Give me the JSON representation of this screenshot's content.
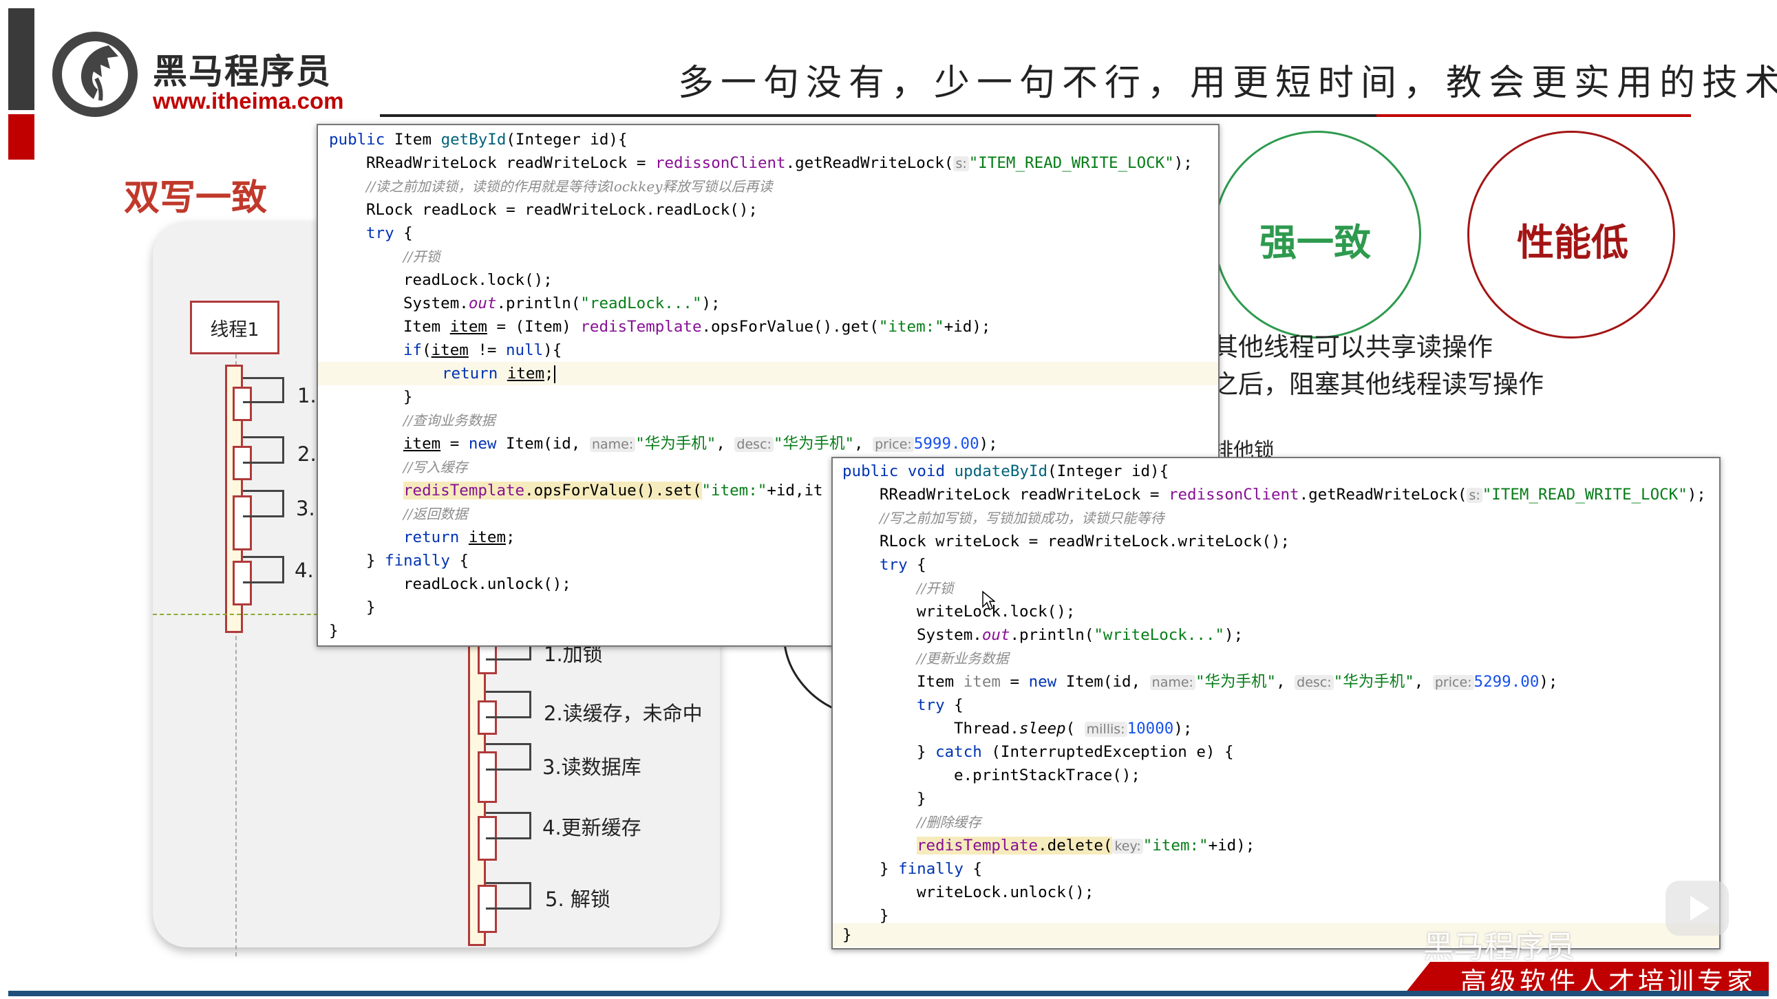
{
  "header": {
    "logo_name": "黑马程序员",
    "logo_url": "www.itheima.com",
    "slogan": "多一句没有，少一句不行，用更短时间，教会更实用的技术！"
  },
  "section_title": "双写一致",
  "diagram": {
    "thread_label": "线程1",
    "top_steps": [
      "1.",
      "2.",
      "3.",
      "4."
    ],
    "bottom_steps": [
      "1.加锁",
      "2.读缓存，未命中",
      "3.读数据库",
      "4.更新缓存",
      "5. 解锁"
    ]
  },
  "circles": {
    "left": {
      "label": "强一致",
      "color": "#2e9a4e"
    },
    "right": {
      "label": "性能低",
      "color": "#a31515"
    }
  },
  "side_text": {
    "line1": "其他线程可以共享读操作",
    "line2": "之后，阻塞其他线程读写操作",
    "line3": "排他锁"
  },
  "code_left": {
    "l1": {
      "a": "public ",
      "b": "Item ",
      "c": "getById",
      "d": "(Integer id){"
    },
    "l2": {
      "a": "RReadWriteLock readWriteLock = ",
      "b": "redissonClient",
      "c": ".getReadWriteLock(",
      "hint": "s:",
      "str": "\"ITEM_READ_WRITE_LOCK\"",
      "d": ");"
    },
    "l3": {
      "cm": "//读之前加读锁，读锁的作用就是等待该lockkey释放写锁以后再读"
    },
    "l4": {
      "a": "RLock readLock = readWriteLock.readLock();"
    },
    "l5": {
      "a": "try",
      "b": " {"
    },
    "l6": {
      "cm": "//开锁"
    },
    "l7": {
      "a": "readLock.lock();"
    },
    "l8": {
      "a": "System.",
      "b": "out",
      "c": ".println(",
      "str": "\"readLock...\"",
      "d": ");"
    },
    "l9": {
      "a": "Item ",
      "b": "item",
      "c": " = (Item) ",
      "d": "redisTemplate",
      "e": ".opsForValue().get(",
      "str": "\"item:\"",
      "f": "+id);"
    },
    "l10": {
      "a": "if",
      "b": "(",
      "c": "item",
      "d": " != ",
      "e": "null",
      "f": "){"
    },
    "l11": {
      "a": "return ",
      "b": "item",
      "c": ";"
    },
    "l12": {
      "a": "}"
    },
    "l13": {
      "cm": "//查询业务数据"
    },
    "l14": {
      "a": "item",
      "b": " = ",
      "c": "new ",
      "d": "Item(id, ",
      "h1": "name:",
      "s1": "\"华为手机\"",
      "e": ", ",
      "h2": "desc:",
      "s2": "\"华为手机\"",
      "f": ", ",
      "h3": "price:",
      "n": "5999.00",
      "g": ");"
    },
    "l15": {
      "cm": "//写入缓存"
    },
    "l16": {
      "a": "redisTemplate",
      "b": ".opsForValue().set(",
      "str": "\"item:\"",
      "c": "+id,it"
    },
    "l17": {
      "cm": "//返回数据"
    },
    "l18": {
      "a": "return ",
      "b": "item",
      "c": ";"
    },
    "l19": {
      "a": "} ",
      "b": "finally",
      "c": " {"
    },
    "l20": {
      "a": "readLock.unlock();"
    },
    "l21": {
      "a": "}"
    },
    "l22": {
      "a": "}"
    }
  },
  "code_right": {
    "l1": {
      "a": "public void ",
      "b": "updateById",
      "c": "(Integer id){"
    },
    "l2": {
      "a": "RReadWriteLock readWriteLock = ",
      "b": "redissonClient",
      "c": ".getReadWriteLock(",
      "hint": "s:",
      "str": "\"ITEM_READ_WRITE_LOCK\"",
      "d": ");"
    },
    "l3": {
      "cm": "//写之前加写锁，写锁加锁成功，读锁只能等待"
    },
    "l4": {
      "a": "RLock writeLock = readWriteLock.writeLock();"
    },
    "l5": {
      "a": "try",
      "b": " {"
    },
    "l6": {
      "cm": "//开锁"
    },
    "l7": {
      "a": "writeLock.lock();"
    },
    "l8": {
      "a": "System.",
      "b": "out",
      "c": ".println(",
      "str": "\"writeLock...\"",
      "d": ");"
    },
    "l9": {
      "cm": "//更新业务数据"
    },
    "l10": {
      "a": "Item ",
      "b": "item",
      "c": " = ",
      "d": "new ",
      "e": "Item(id, ",
      "h1": "name:",
      "s1": "\"华为手机\"",
      "f": ", ",
      "h2": "desc:",
      "s2": "\"华为手机\"",
      "g": ", ",
      "h3": "price:",
      "n": "5299.00",
      "i": ");"
    },
    "l11": {
      "a": "try",
      "b": " {"
    },
    "l12": {
      "a": "Thread.",
      "b": "sleep",
      "c": "( ",
      "hint": "millis:",
      "n": "10000",
      "d": ");"
    },
    "l13": {
      "a": "} ",
      "b": "catch",
      "c": " (InterruptedException e) {"
    },
    "l14": {
      "a": "e.printStackTrace();"
    },
    "l15": {
      "a": "}"
    },
    "l16": {
      "cm": "//删除缓存"
    },
    "l17": {
      "a": "redisTemplate",
      "b": ".delete(",
      "hint": "key:",
      "str": "\"item:\"",
      "c": "+id);"
    },
    "l18": {
      "a": "} ",
      "b": "finally",
      "c": " {"
    },
    "l19": {
      "a": "writeLock.unlock();"
    },
    "l20": {
      "a": "}"
    },
    "l21": {
      "a": "}"
    }
  },
  "footer": {
    "slogan": "高级软件人才培训专家",
    "watermark": "黑马程序员"
  },
  "colors": {
    "brand_red": "#c00000",
    "dark_bar": "#3a3a3a",
    "footer_blue": "#1f4f7a"
  }
}
